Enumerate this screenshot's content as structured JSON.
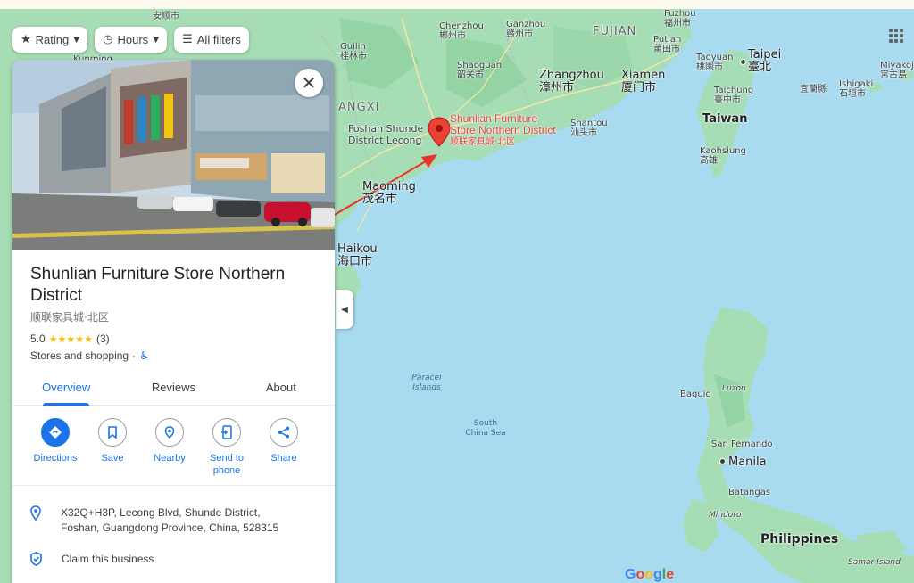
{
  "filters": {
    "rating": "Rating",
    "hours": "Hours",
    "all_filters": "All filters"
  },
  "place": {
    "name": "Shunlian Furniture Store Northern District",
    "name_zh": "顺联家具城·北区",
    "rating": "5.0",
    "stars": "★★★★★",
    "review_count": "(3)",
    "category": "Stores and shopping",
    "accessibility_icon": "wheelchair-icon"
  },
  "tabs": [
    "Overview",
    "Reviews",
    "About"
  ],
  "actions": {
    "directions": "Directions",
    "save": "Save",
    "nearby": "Nearby",
    "send_to_phone": "Send to phone",
    "share": "Share"
  },
  "info": {
    "address": "X32Q+H3P, Lecong Blvd, Shunde District, Foshan, Guangdong Province, China, 528315",
    "claim": "Claim this business"
  },
  "map": {
    "pin_label_en": "Shunlian Furniture Store Northern District",
    "pin_label_zh": "顺联家具城·北区",
    "places": {
      "anshun": "安顺市",
      "kunming": "Kunming",
      "guilin_en": "Guilin",
      "guilin_zh": "桂林市",
      "chenzhou_en": "Chenzhou",
      "chenzhou_zh": "郴州市",
      "ganzhou_en": "Ganzhou",
      "ganzhou_zh": "赣州市",
      "fujian": "FUJIAN",
      "fuzhou_en": "Fuzhou",
      "fuzhou_zh": "福州市",
      "putian_en": "Putian",
      "putian_zh": "莆田市",
      "shaoguan_en": "Shaoguan",
      "shaoguan_zh": "韶关市",
      "zhangzhou_en": "Zhangzhou",
      "zhangzhou_zh": "漳州市",
      "xiamen_en": "Xiamen",
      "xiamen_zh": "厦门市",
      "taoyuan_en": "Taoyuan",
      "taoyuan_zh": "桃園市",
      "taipei_en": "Taipei",
      "taipei_zh": "臺北",
      "yilan": "宜蘭縣",
      "ishigaki_en": "Ishigaki",
      "ishigaki_zh": "石垣市",
      "miyako_en": "Miyakoj",
      "miyako_zh": "宮古島",
      "taichung_en": "Taichung",
      "taichung_zh": "臺中市",
      "taiwan": "Taiwan",
      "kaohsiung_en": "Kaohsiung",
      "kaohsiung_zh": "高雄",
      "angxi": "ANGXI",
      "foshan_en": "Foshan Shunde",
      "foshan_zh": "District Lecong",
      "shantou_en": "Shantou",
      "shantou_zh": "汕头市",
      "maoming_en": "Maoming",
      "maoming_zh": "茂名市",
      "haikou_en": "Haikou",
      "haikou_zh": "海口市",
      "paracel": "Paracel Islands",
      "south_china_sea": "South China Sea",
      "luzon": "Luzon",
      "baguio": "Baguio",
      "san_fernando": "San Fernando",
      "manila": "Manila",
      "batangas": "Batangas",
      "mindoro": "Mindoro",
      "philippines": "Philippines",
      "samar": "Samar Island"
    }
  },
  "branding": {
    "google": "Google"
  },
  "colors": {
    "sea": "#a8dbef",
    "land": "#a7ddb5",
    "accent": "#1a73e8",
    "pin": "#ea4335",
    "arrow": "#e8322a"
  }
}
